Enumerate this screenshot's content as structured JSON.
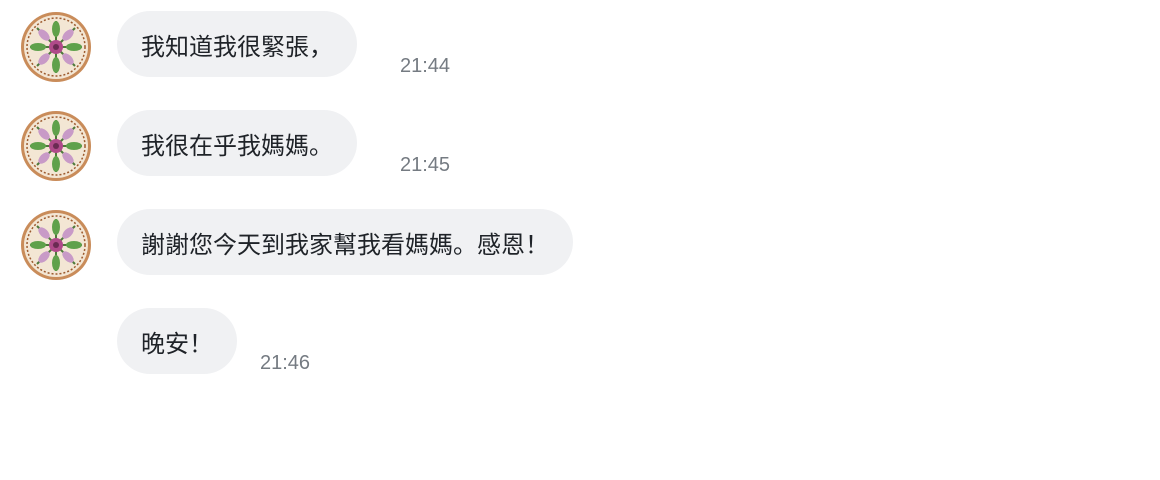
{
  "chat": {
    "messages": [
      {
        "text": "我知道我很緊張，",
        "time": "21:44",
        "avatar": "mandala-avatar"
      },
      {
        "text": "我很在乎我媽媽。",
        "time": "21:45",
        "avatar": "mandala-avatar"
      },
      {
        "text": "謝謝您今天到我家幫我看媽媽。感恩！",
        "time": "",
        "avatar": "mandala-avatar"
      },
      {
        "text": "晚安！",
        "time": "21:46",
        "avatar": ""
      }
    ]
  },
  "colors": {
    "bubble": "#f0f1f3",
    "text": "#1f2328",
    "timestamp": "#757b82"
  }
}
